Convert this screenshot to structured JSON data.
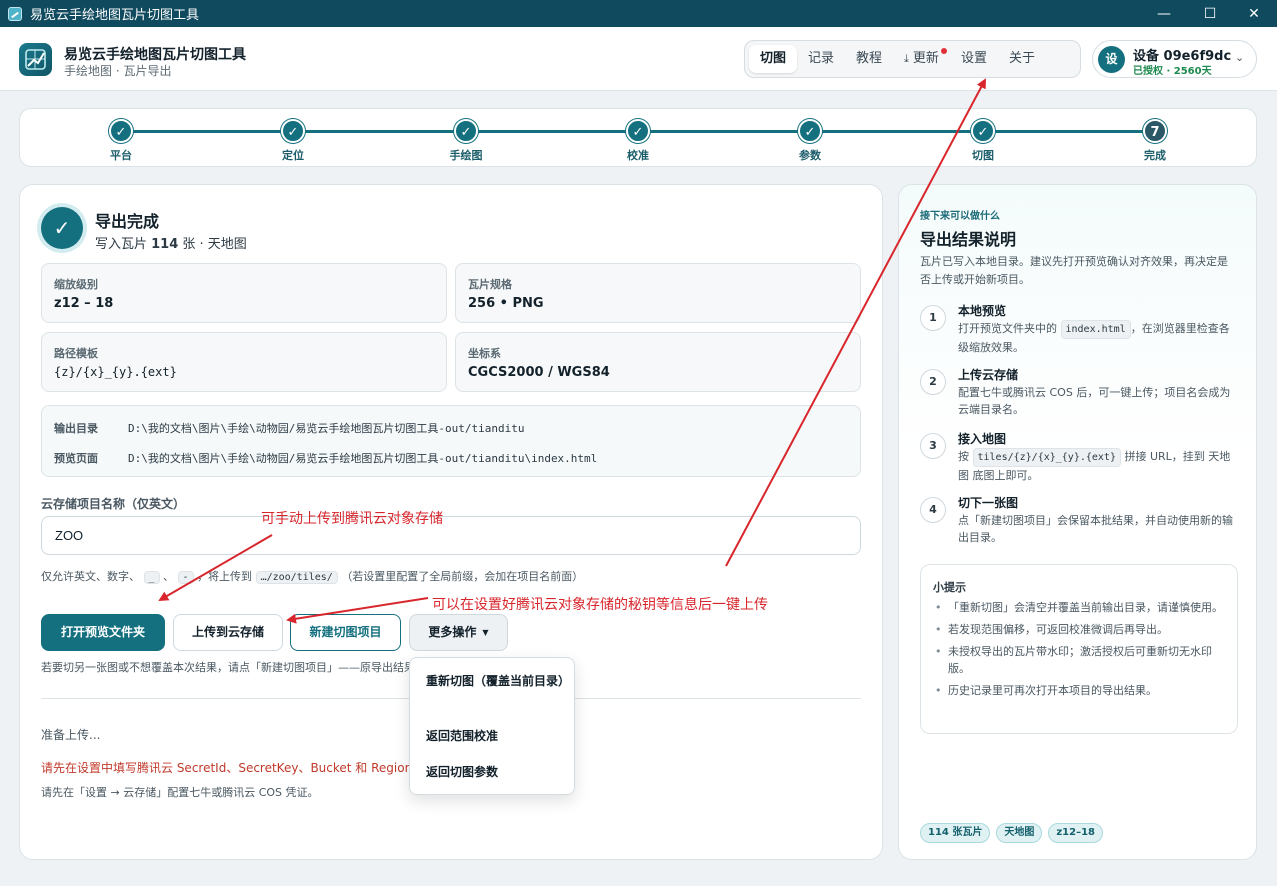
{
  "window": {
    "title": "易览云手绘地图瓦片切图工具",
    "minimize": "—",
    "maximize": "☐",
    "close": "✕"
  },
  "header": {
    "app_title": "易览云手绘地图瓦片切图工具",
    "app_subtitle": "手绘地图 · 瓦片导出",
    "nav": {
      "cut": "切图",
      "records": "记录",
      "tutorial": "教程",
      "update_icon": "⤓",
      "update": "更新",
      "settings": "设置",
      "about": "关于"
    },
    "device": {
      "avatar": "设",
      "name": "设备 09e6f9dc",
      "status": "已授权 · 2560天",
      "chevron": "⌄"
    }
  },
  "stepper": {
    "steps": [
      {
        "label": "平台",
        "mark": "✓"
      },
      {
        "label": "定位",
        "mark": "✓"
      },
      {
        "label": "手绘图",
        "mark": "✓"
      },
      {
        "label": "校准",
        "mark": "✓"
      },
      {
        "label": "参数",
        "mark": "✓"
      },
      {
        "label": "切图",
        "mark": "✓"
      },
      {
        "label": "完成",
        "mark": "7"
      }
    ]
  },
  "result": {
    "check": "✓",
    "title": "导出完成",
    "sub_prefix": "写入瓦片 ",
    "tile_count": "114",
    "sub_suffix": " 张 · 天地图",
    "zoom_label": "缩放级别",
    "zoom_value": "z12 – 18",
    "spec_label": "瓦片规格",
    "spec_value": "256 • PNG",
    "template_label": "路径模板",
    "template_value": "{z}/{x}_{y}.{ext}",
    "crs_label": "坐标系",
    "crs_value": "CGCS2000 / WGS84",
    "output_dir_label": "输出目录",
    "output_dir_value": "D:\\我的文档\\图片\\手绘\\动物园/易览云手绘地图瓦片切图工具-out/tianditu",
    "preview_label": "预览页面",
    "preview_value": "D:\\我的文档\\图片\\手绘\\动物园/易览云手绘地图瓦片切图工具-out/tianditu\\index.html"
  },
  "cloud": {
    "label": "云存储项目名称（仅英文）",
    "value": "ZOO",
    "hint_1": "仅允许英文、数字、",
    "hint_code_1": "_",
    "hint_sep": "、",
    "hint_code_2": "-",
    "hint_2": "，将上传到",
    "hint_code_3": "…/zoo/tiles/",
    "hint_3": "（若设置里配置了全局前缀，会加在项目名前面）"
  },
  "actions": {
    "open_preview": "打开预览文件夹",
    "upload": "上传到云存储",
    "new_project": "新建切图项目",
    "more": "更多操作",
    "more_caret": "▼",
    "note": "若要切另一张图或不想覆盖本次结果，请点「新建切图项目」——原导出结果会保留。"
  },
  "menu": {
    "recut": "重新切图（覆盖当前目录）",
    "back_calibrate": "返回范围校准",
    "back_params": "返回切图参数"
  },
  "status": {
    "preparing": "准备上传...",
    "error": "请先在设置中填写腾讯云 SecretId、SecretKey、Bucket 和 Region",
    "advice": "请先在「设置 → 云存储」配置七牛或腾讯云 COS 凭证。"
  },
  "side": {
    "eyebrow": "接下来可以做什么",
    "title": "导出结果说明",
    "desc": "瓦片已写入本地目录。建议先打开预览确认对齐效果，再决定是否上传或开始新项目。",
    "steps": [
      {
        "num": "1",
        "title": "本地预览",
        "desc_a": "打开预览文件夹中的",
        "code": "index.html",
        "desc_b": "，在浏览器里检查各级缩放效果。"
      },
      {
        "num": "2",
        "title": "上传云存储",
        "desc_a": "配置七牛或腾讯云 COS 后，可一键上传；项目名会成为云端目录名。",
        "code": "",
        "desc_b": ""
      },
      {
        "num": "3",
        "title": "接入地图",
        "desc_a": "按",
        "code": "tiles/{z}/{x}_{y}.{ext}",
        "desc_b": "拼接 URL，挂到 天地图 底图上即可。"
      },
      {
        "num": "4",
        "title": "切下一张图",
        "desc_a": "点「新建切图项目」会保留本批结果，并自动使用新的输出目录。",
        "code": "",
        "desc_b": ""
      }
    ],
    "tips_title": "小提示",
    "tips": [
      "「重新切图」会清空并覆盖当前输出目录，请谨慎使用。",
      "若发现范围偏移，可返回校准微调后再导出。",
      "未授权导出的瓦片带水印；激活授权后可重新切无水印版。",
      "历史记录里可再次打开本项目的导出结果。"
    ],
    "tags": [
      "114 张瓦片",
      "天地图",
      "z12–18"
    ]
  },
  "annotations": {
    "manual_upload": "可手动上传到腾讯云对象存储",
    "one_click": "可以在设置好腾讯云对象存储的秘钥等信息后一键上传"
  },
  "colors": {
    "accent": "#14707f",
    "titlebar": "#0f4a5f",
    "annotation": "#d8262c",
    "error": "#c0392b"
  }
}
